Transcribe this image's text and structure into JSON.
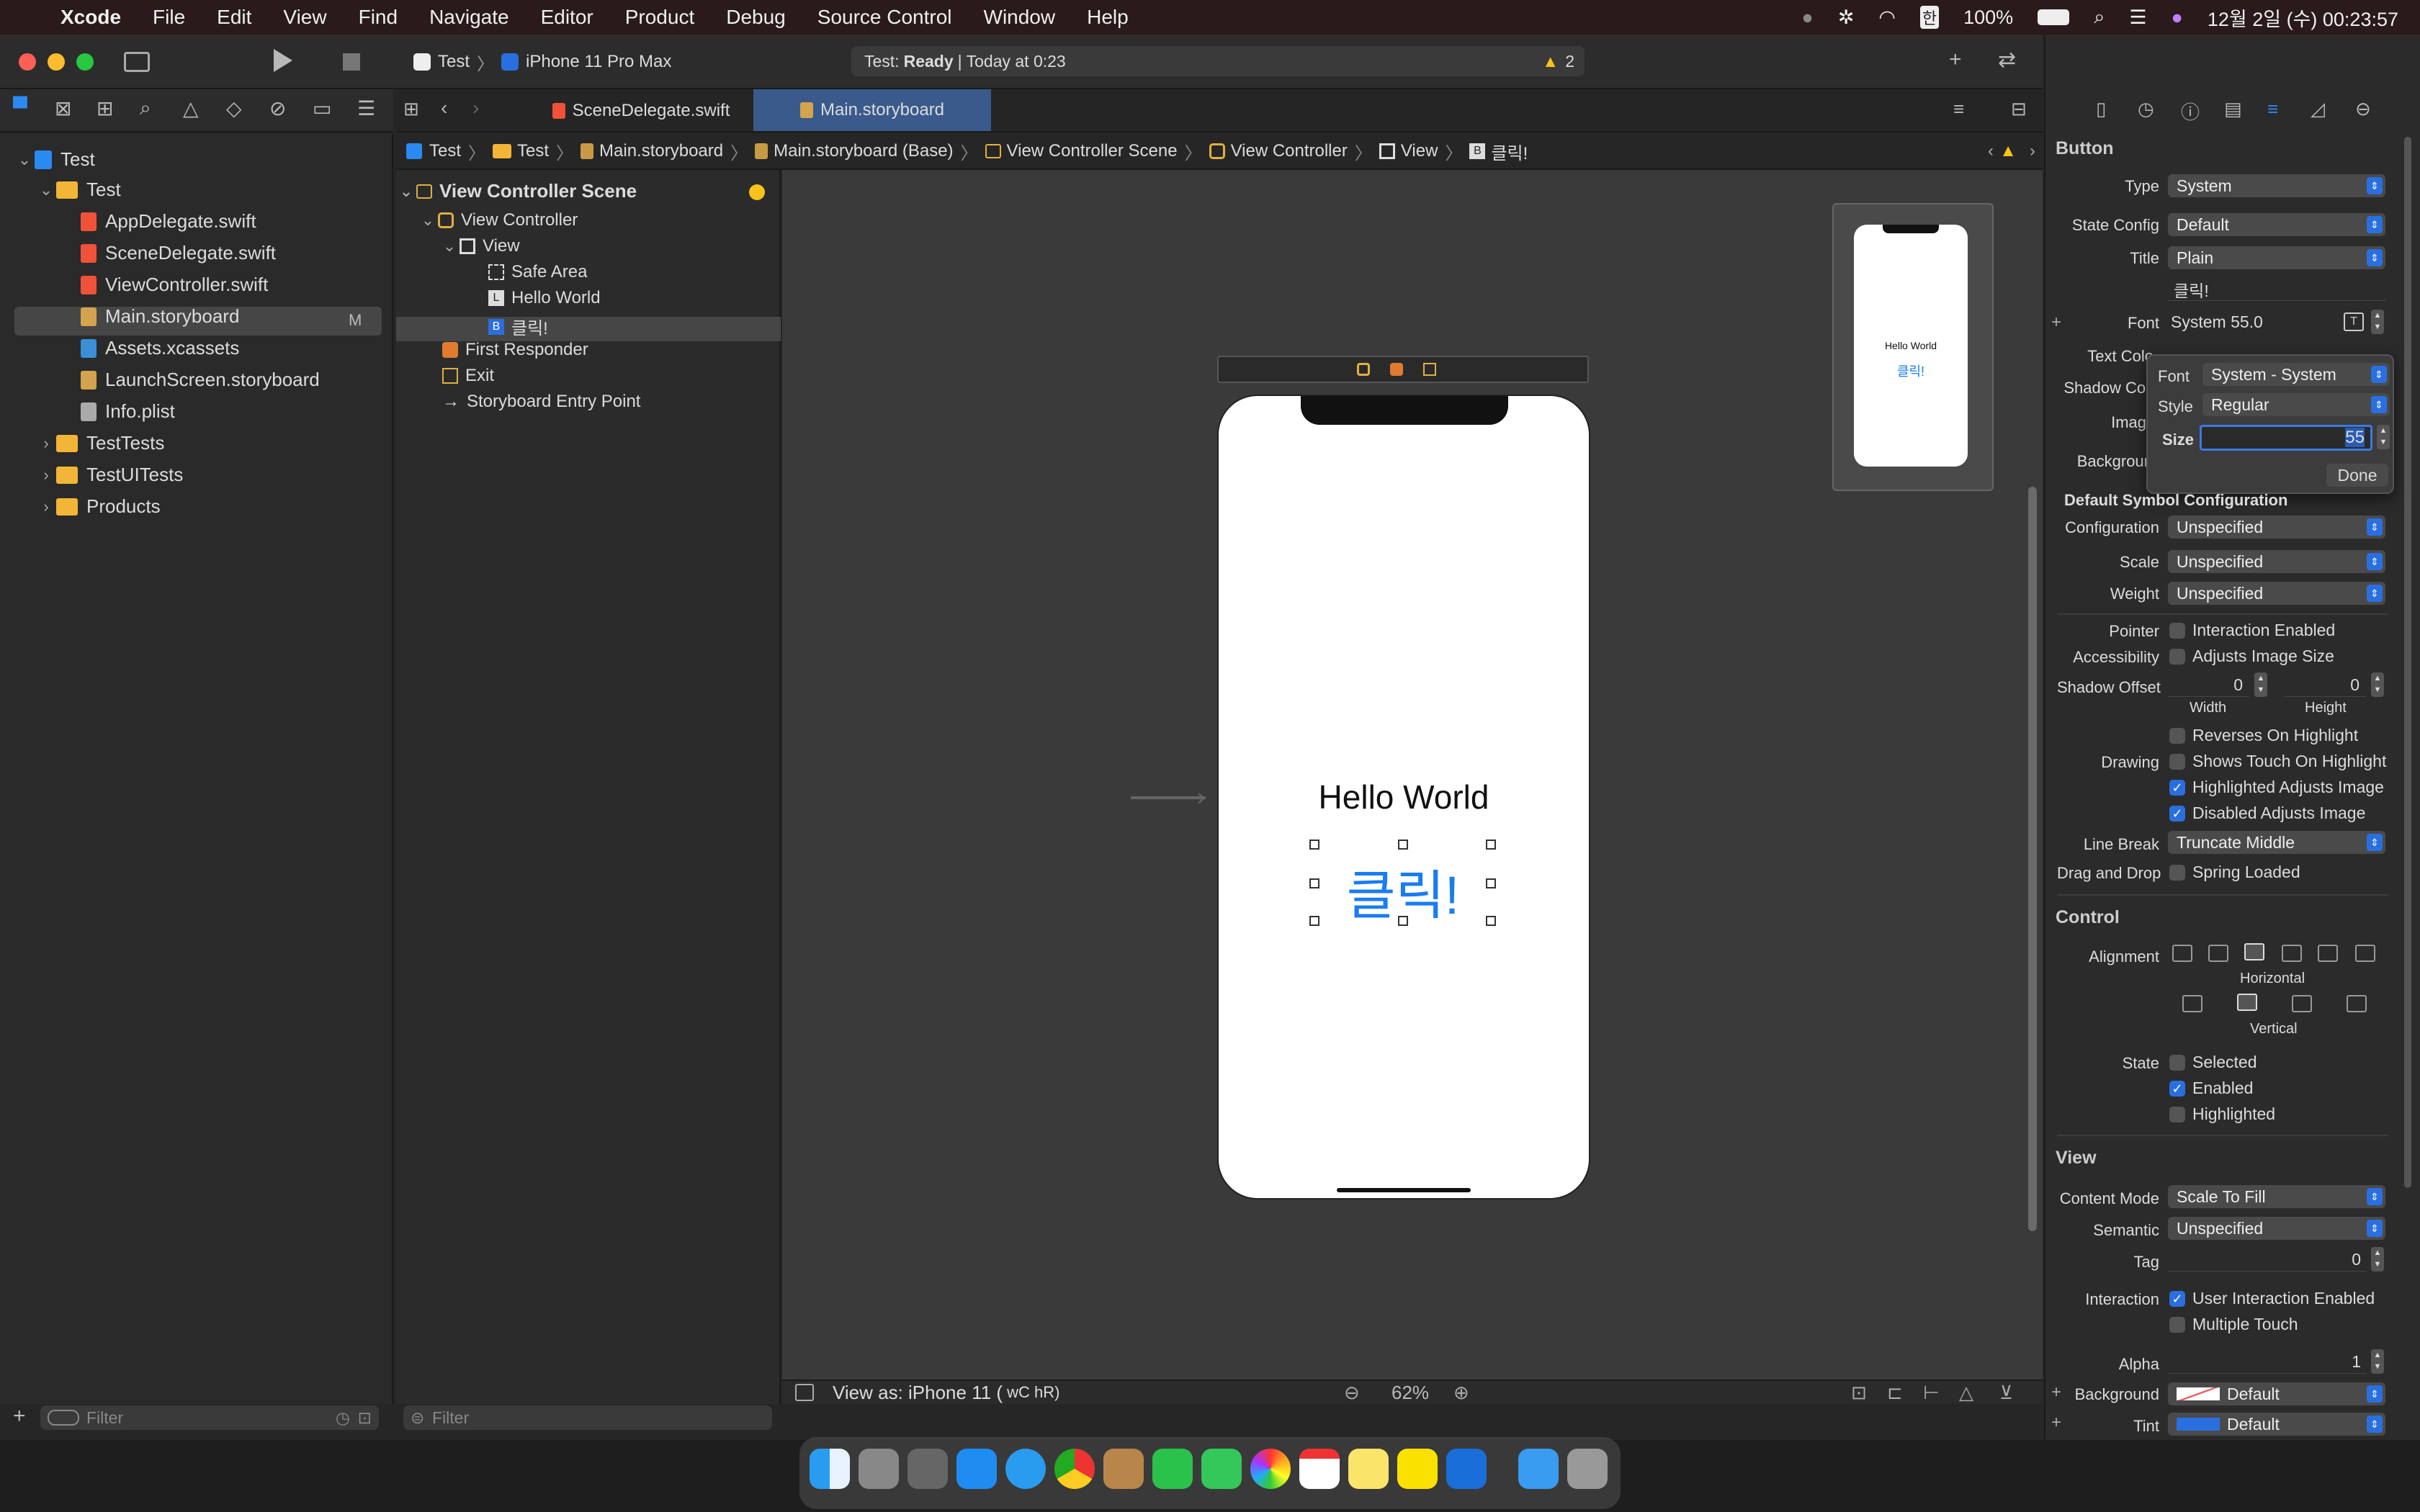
{
  "menubar": {
    "app_name": "Xcode",
    "items": [
      "File",
      "Edit",
      "View",
      "Find",
      "Navigate",
      "Editor",
      "Product",
      "Debug",
      "Source Control",
      "Window",
      "Help"
    ],
    "battery": "100%",
    "clock": "12월 2일 (수) 00:23:57",
    "input_method": "한"
  },
  "toolbar": {
    "scheme": "Test",
    "device": "iPhone 11 Pro Max",
    "status_prefix": "Test:",
    "status_state": "Ready",
    "status_time": "Today at 0:23",
    "warning_count": "2"
  },
  "tabs": [
    {
      "label": "SceneDelegate.swift",
      "active": false
    },
    {
      "label": "Main.storyboard",
      "active": true
    }
  ],
  "jumpbar": [
    "Test",
    "Test",
    "Main.storyboard",
    "Main.storyboard (Base)",
    "View Controller Scene",
    "View Controller",
    "View",
    "클릭!"
  ],
  "navigator": {
    "project": "Test",
    "group": "Test",
    "files": [
      {
        "name": "AppDelegate.swift",
        "badge": ""
      },
      {
        "name": "SceneDelegate.swift",
        "badge": ""
      },
      {
        "name": "ViewController.swift",
        "badge": ""
      },
      {
        "name": "Main.storyboard",
        "badge": "M"
      },
      {
        "name": "Assets.xcassets",
        "badge": ""
      },
      {
        "name": "LaunchScreen.storyboard",
        "badge": ""
      },
      {
        "name": "Info.plist",
        "badge": ""
      }
    ],
    "groups": [
      "TestTests",
      "TestUITests",
      "Products"
    ],
    "filter_placeholder": "Filter"
  },
  "outline": {
    "scene": "View Controller Scene",
    "items": [
      "View Controller",
      "View",
      "Safe Area",
      "Hello World",
      "클릭!",
      "First Responder",
      "Exit",
      "Storyboard Entry Point"
    ],
    "item_glyphs": [
      "",
      "",
      "",
      "L",
      "B",
      "",
      "",
      ""
    ],
    "filter_placeholder": "Filter"
  },
  "canvas": {
    "label_text": "Hello World",
    "button_text": "클릭!",
    "minimap_label": "Hello World",
    "minimap_button": "클릭!",
    "view_as": "View as: iPhone 11 (",
    "size_class": "wC hR)",
    "zoom": "62%"
  },
  "inspector": {
    "section_button": "Button",
    "type_label": "Type",
    "type_value": "System",
    "state_label": "State Config",
    "state_value": "Default",
    "title_label": "Title",
    "title_value": "Plain",
    "title_text": "클릭!",
    "font_label": "Font",
    "font_value": "System 55.0",
    "text_color_label": "Text Colo",
    "shadow_color_label": "Shadow Col",
    "image_label": "Imag",
    "background_label": "Backgrour",
    "font_popover": {
      "font_label": "Font",
      "font_value": "System - System",
      "style_label": "Style",
      "style_value": "Regular",
      "size_label": "Size",
      "size_value": "55",
      "done": "Done"
    },
    "symbol_config_heading": "Default Symbol Configuration",
    "configuration_label": "Configuration",
    "configuration_value": "Unspecified",
    "scale_label": "Scale",
    "scale_value": "Unspecified",
    "weight_label": "Weight",
    "weight_value": "Unspecified",
    "pointer_label": "Pointer",
    "pointer_check": "Interaction Enabled",
    "accessibility_label": "Accessibility",
    "accessibility_check": "Adjusts Image Size",
    "shadow_offset_label": "Shadow Offset",
    "shadow_w": "0",
    "shadow_h": "0",
    "width_label": "Width",
    "height_label": "Height",
    "reverses": "Reverses On Highlight",
    "drawing_label": "Drawing",
    "shows_touch": "Shows Touch On Highlight",
    "highlighted_adjusts": "Highlighted Adjusts Image",
    "disabled_adjusts": "Disabled Adjusts Image",
    "line_break_label": "Line Break",
    "line_break_value": "Truncate Middle",
    "drag_label": "Drag and Drop",
    "drag_check": "Spring Loaded",
    "section_control": "Control",
    "alignment_label": "Alignment",
    "horizontal_label": "Horizontal",
    "vertical_label": "Vertical",
    "state_label2": "State",
    "state_selected": "Selected",
    "state_enabled": "Enabled",
    "state_highlighted": "Highlighted",
    "section_view": "View",
    "content_mode_label": "Content Mode",
    "content_mode_value": "Scale To Fill",
    "semantic_label": "Semantic",
    "semantic_value": "Unspecified",
    "tag_label": "Tag",
    "tag_value": "0",
    "interaction_label": "Interaction",
    "user_interaction": "User Interaction Enabled",
    "multiple_touch": "Multiple Touch",
    "alpha_label": "Alpha",
    "alpha_value": "1",
    "background_label2": "Background",
    "background_value": "Default",
    "tint_label": "Tint",
    "tint_value": "Default"
  },
  "colors": {
    "accent": "#2a6fe0",
    "button_blue": "#1a7cf0",
    "warning": "#f7c21a"
  }
}
